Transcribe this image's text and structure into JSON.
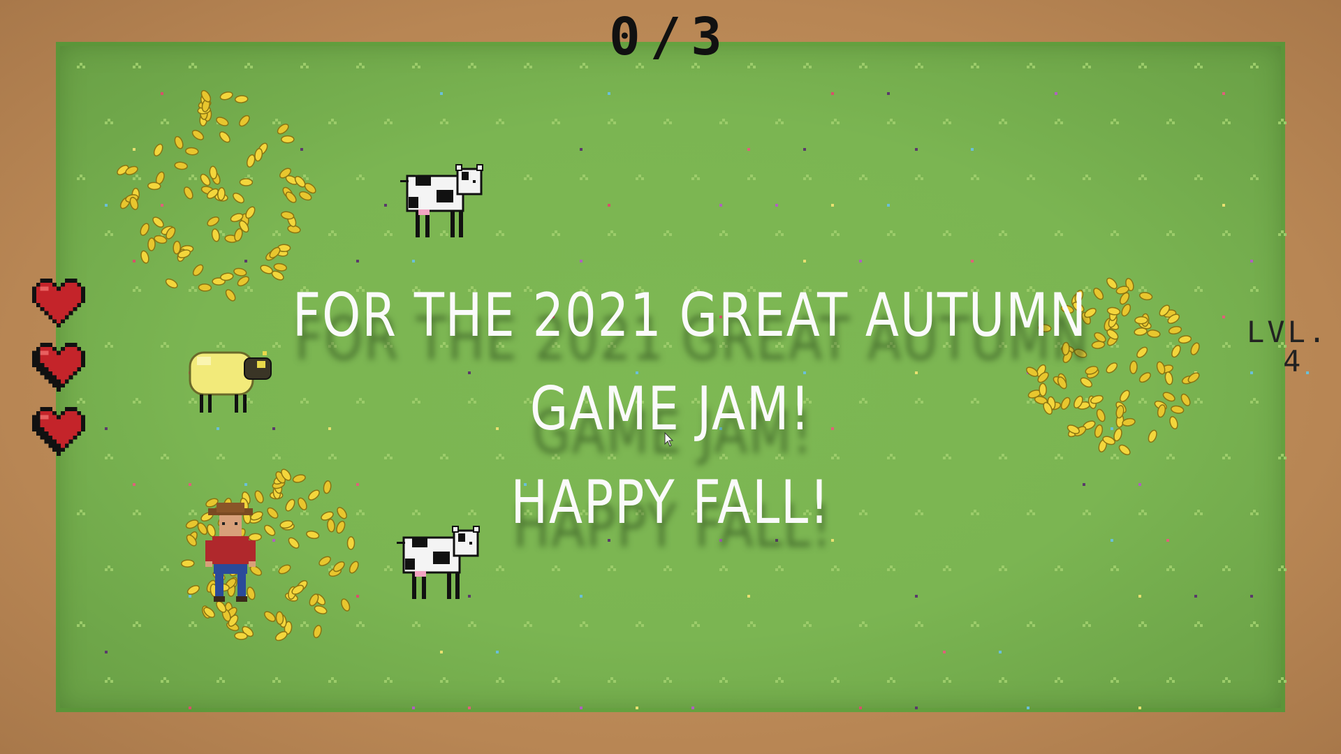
{
  "hud": {
    "score": "0/3",
    "level_label": "LVL.",
    "level_value": "4",
    "hearts": [
      "heart-icon",
      "heart-icon",
      "heart-icon"
    ]
  },
  "message": {
    "line1": "FOR THE 2021 GREAT AUTUMN",
    "line2": "GAME JAM!",
    "line3": "HAPPY FALL!"
  },
  "colors": {
    "border": "#c0905c",
    "grass": "#7bb552",
    "heart": "#c4242a",
    "leaf": "#f1d23a",
    "text": "#fafafa"
  },
  "sprites": [
    "cow-sprite",
    "cow-sprite",
    "sheep-sprite",
    "farmer-sprite",
    "leaf-pile",
    "leaf-pile",
    "leaf-pile"
  ]
}
